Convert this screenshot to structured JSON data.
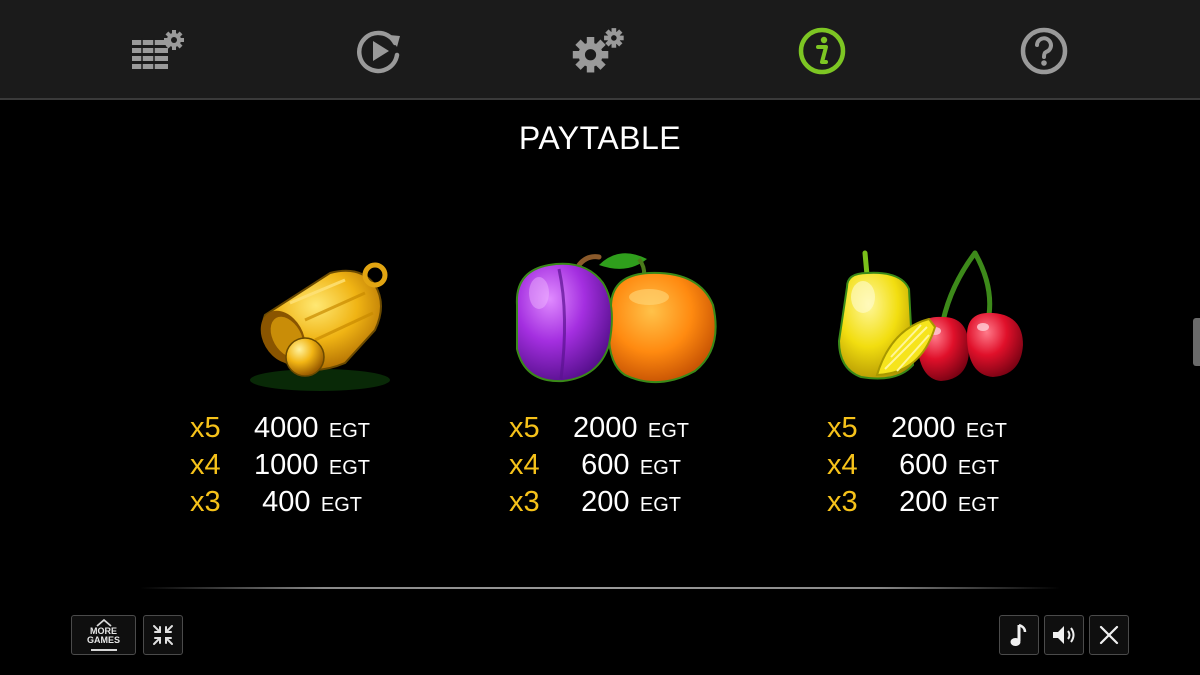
{
  "nav": {
    "items": [
      {
        "icon": "bet-settings-icon"
      },
      {
        "icon": "autoplay-icon"
      },
      {
        "icon": "settings-gears-icon"
      },
      {
        "icon": "info-icon",
        "active": true,
        "color": "#7dc623"
      },
      {
        "icon": "help-icon"
      }
    ]
  },
  "title": "PAYTABLE",
  "paytable": [
    {
      "symbol": "bell-icon",
      "lines": [
        {
          "mult": "x5",
          "amount": "4000",
          "currency": "EGT"
        },
        {
          "mult": "x4",
          "amount": "1000",
          "currency": "EGT"
        },
        {
          "mult": "x3",
          "amount": "400",
          "currency": "EGT"
        }
      ]
    },
    {
      "symbol": "plum-orange-icon",
      "lines": [
        {
          "mult": "x5",
          "amount": "2000",
          "currency": "EGT"
        },
        {
          "mult": "x4",
          "amount": "600",
          "currency": "EGT"
        },
        {
          "mult": "x3",
          "amount": "200",
          "currency": "EGT"
        }
      ]
    },
    {
      "symbol": "lemon-cherry-icon",
      "lines": [
        {
          "mult": "x5",
          "amount": "2000",
          "currency": "EGT"
        },
        {
          "mult": "x4",
          "amount": "600",
          "currency": "EGT"
        },
        {
          "mult": "x3",
          "amount": "200",
          "currency": "EGT"
        }
      ]
    }
  ],
  "bottom": {
    "more_games_label": "MORE\nGAMES",
    "left_icons": [
      "more-games-icon",
      "exit-fullscreen-icon"
    ],
    "right_icons": [
      "music-icon",
      "sound-icon",
      "close-icon"
    ]
  },
  "colors": {
    "multiplier": "#f6c21a",
    "active_nav": "#7dc623",
    "inactive_nav": "#9a9a9a"
  }
}
